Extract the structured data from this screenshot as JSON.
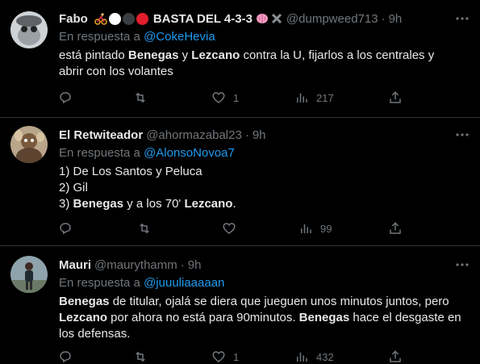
{
  "tweets": [
    {
      "name": "Fabo",
      "name_suffix": "BASTA DEL 4-3-3",
      "emoji_colors": [
        "#ffffff",
        "#3a3d42",
        "#e11d2e"
      ],
      "handle": "@dumpweed713",
      "dot": "·",
      "time": "9h",
      "reply_prefix": "En respuesta a ",
      "reply_to": "@CokeHevia",
      "text_parts": [
        {
          "t": "está pintado ",
          "b": false
        },
        {
          "t": "Benegas",
          "b": true
        },
        {
          "t": " y ",
          "b": false
        },
        {
          "t": "Lezcano",
          "b": true
        },
        {
          "t": " contra la U, fijarlos a los centrales y abrir con los volantes",
          "b": false
        }
      ],
      "likes": "1",
      "views": "217"
    },
    {
      "name": "El Retwiteador",
      "handle": "@ahormazabal23",
      "dot": "·",
      "time": "9h",
      "reply_prefix": "En respuesta a ",
      "reply_to": "@AlonsoNovoa7",
      "lines": [
        "1) De Los Santos y Peluca",
        "2) Gil"
      ],
      "line3_parts": [
        {
          "t": "3) ",
          "b": false
        },
        {
          "t": "Benegas",
          "b": true
        },
        {
          "t": " y a los 70' ",
          "b": false
        },
        {
          "t": "Lezcano",
          "b": true
        },
        {
          "t": ".",
          "b": false
        }
      ],
      "views": "99"
    },
    {
      "name": "Mauri",
      "handle": "@maurythamm",
      "dot": "·",
      "time": "9h",
      "reply_prefix": "En respuesta a ",
      "reply_to": "@juuuliaaaaan",
      "text_parts": [
        {
          "t": "Benegas",
          "b": true
        },
        {
          "t": " de titular, ojalá se diera que jueguen unos minutos juntos, pero ",
          "b": false
        },
        {
          "t": "Lezcano",
          "b": true
        },
        {
          "t": " por ahora no está para 90minutos. ",
          "b": false
        },
        {
          "t": "Benegas",
          "b": true
        },
        {
          "t": " hace el desgaste en los defensas.",
          "b": false
        }
      ],
      "likes": "1",
      "views": "432"
    }
  ]
}
